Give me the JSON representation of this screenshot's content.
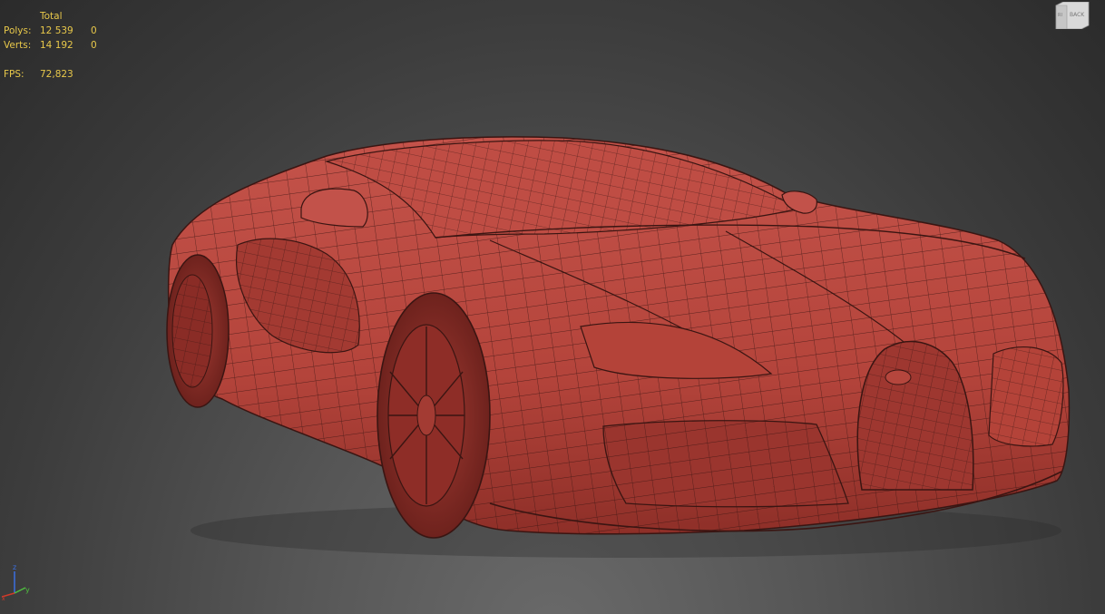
{
  "stats": {
    "header": "Total",
    "polys_label": "Polys:",
    "polys_total": "12 539",
    "polys_selected": "0",
    "verts_label": "Verts:",
    "verts_total": "14 192",
    "verts_selected": "0",
    "fps_label": "FPS:",
    "fps_value": "72,823"
  },
  "viewcube": {
    "face_label": "BACK",
    "side_label": "RI"
  },
  "axis_gizmo": {
    "z": "z",
    "y": "y",
    "x": "x"
  },
  "colors": {
    "stats_text": "#e8c84a",
    "mesh_fill": "#b8463c",
    "wire": "#3a1512",
    "background": "#3c3c3c"
  }
}
